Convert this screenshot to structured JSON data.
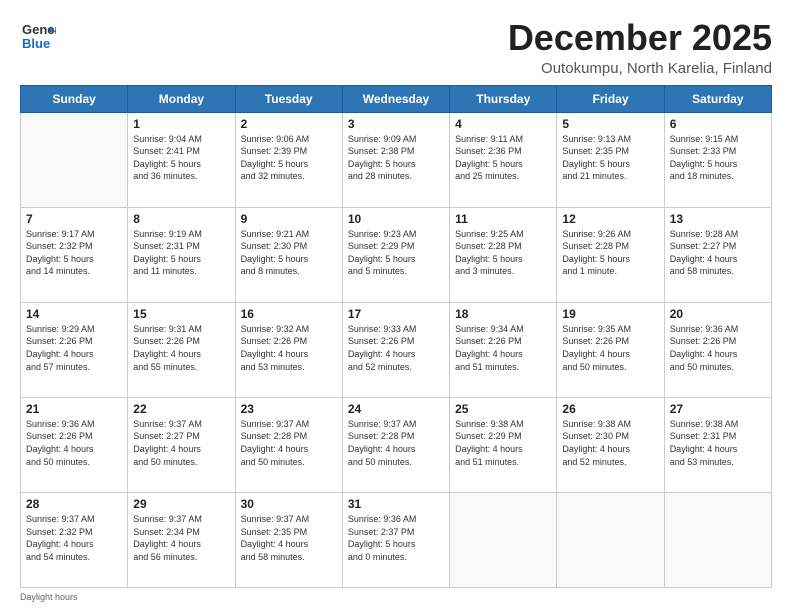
{
  "header": {
    "logo_general": "General",
    "logo_blue": "Blue",
    "month_title": "December 2025",
    "location": "Outokumpu, North Karelia, Finland"
  },
  "days_of_week": [
    "Sunday",
    "Monday",
    "Tuesday",
    "Wednesday",
    "Thursday",
    "Friday",
    "Saturday"
  ],
  "weeks": [
    [
      {
        "day": "",
        "info": ""
      },
      {
        "day": "1",
        "info": "Sunrise: 9:04 AM\nSunset: 2:41 PM\nDaylight: 5 hours\nand 36 minutes."
      },
      {
        "day": "2",
        "info": "Sunrise: 9:06 AM\nSunset: 2:39 PM\nDaylight: 5 hours\nand 32 minutes."
      },
      {
        "day": "3",
        "info": "Sunrise: 9:09 AM\nSunset: 2:38 PM\nDaylight: 5 hours\nand 28 minutes."
      },
      {
        "day": "4",
        "info": "Sunrise: 9:11 AM\nSunset: 2:36 PM\nDaylight: 5 hours\nand 25 minutes."
      },
      {
        "day": "5",
        "info": "Sunrise: 9:13 AM\nSunset: 2:35 PM\nDaylight: 5 hours\nand 21 minutes."
      },
      {
        "day": "6",
        "info": "Sunrise: 9:15 AM\nSunset: 2:33 PM\nDaylight: 5 hours\nand 18 minutes."
      }
    ],
    [
      {
        "day": "7",
        "info": "Sunrise: 9:17 AM\nSunset: 2:32 PM\nDaylight: 5 hours\nand 14 minutes."
      },
      {
        "day": "8",
        "info": "Sunrise: 9:19 AM\nSunset: 2:31 PM\nDaylight: 5 hours\nand 11 minutes."
      },
      {
        "day": "9",
        "info": "Sunrise: 9:21 AM\nSunset: 2:30 PM\nDaylight: 5 hours\nand 8 minutes."
      },
      {
        "day": "10",
        "info": "Sunrise: 9:23 AM\nSunset: 2:29 PM\nDaylight: 5 hours\nand 5 minutes."
      },
      {
        "day": "11",
        "info": "Sunrise: 9:25 AM\nSunset: 2:28 PM\nDaylight: 5 hours\nand 3 minutes."
      },
      {
        "day": "12",
        "info": "Sunrise: 9:26 AM\nSunset: 2:28 PM\nDaylight: 5 hours\nand 1 minute."
      },
      {
        "day": "13",
        "info": "Sunrise: 9:28 AM\nSunset: 2:27 PM\nDaylight: 4 hours\nand 58 minutes."
      }
    ],
    [
      {
        "day": "14",
        "info": "Sunrise: 9:29 AM\nSunset: 2:26 PM\nDaylight: 4 hours\nand 57 minutes."
      },
      {
        "day": "15",
        "info": "Sunrise: 9:31 AM\nSunset: 2:26 PM\nDaylight: 4 hours\nand 55 minutes."
      },
      {
        "day": "16",
        "info": "Sunrise: 9:32 AM\nSunset: 2:26 PM\nDaylight: 4 hours\nand 53 minutes."
      },
      {
        "day": "17",
        "info": "Sunrise: 9:33 AM\nSunset: 2:26 PM\nDaylight: 4 hours\nand 52 minutes."
      },
      {
        "day": "18",
        "info": "Sunrise: 9:34 AM\nSunset: 2:26 PM\nDaylight: 4 hours\nand 51 minutes."
      },
      {
        "day": "19",
        "info": "Sunrise: 9:35 AM\nSunset: 2:26 PM\nDaylight: 4 hours\nand 50 minutes."
      },
      {
        "day": "20",
        "info": "Sunrise: 9:36 AM\nSunset: 2:26 PM\nDaylight: 4 hours\nand 50 minutes."
      }
    ],
    [
      {
        "day": "21",
        "info": "Sunrise: 9:36 AM\nSunset: 2:26 PM\nDaylight: 4 hours\nand 50 minutes."
      },
      {
        "day": "22",
        "info": "Sunrise: 9:37 AM\nSunset: 2:27 PM\nDaylight: 4 hours\nand 50 minutes."
      },
      {
        "day": "23",
        "info": "Sunrise: 9:37 AM\nSunset: 2:28 PM\nDaylight: 4 hours\nand 50 minutes."
      },
      {
        "day": "24",
        "info": "Sunrise: 9:37 AM\nSunset: 2:28 PM\nDaylight: 4 hours\nand 50 minutes."
      },
      {
        "day": "25",
        "info": "Sunrise: 9:38 AM\nSunset: 2:29 PM\nDaylight: 4 hours\nand 51 minutes."
      },
      {
        "day": "26",
        "info": "Sunrise: 9:38 AM\nSunset: 2:30 PM\nDaylight: 4 hours\nand 52 minutes."
      },
      {
        "day": "27",
        "info": "Sunrise: 9:38 AM\nSunset: 2:31 PM\nDaylight: 4 hours\nand 53 minutes."
      }
    ],
    [
      {
        "day": "28",
        "info": "Sunrise: 9:37 AM\nSunset: 2:32 PM\nDaylight: 4 hours\nand 54 minutes."
      },
      {
        "day": "29",
        "info": "Sunrise: 9:37 AM\nSunset: 2:34 PM\nDaylight: 4 hours\nand 56 minutes."
      },
      {
        "day": "30",
        "info": "Sunrise: 9:37 AM\nSunset: 2:35 PM\nDaylight: 4 hours\nand 58 minutes."
      },
      {
        "day": "31",
        "info": "Sunrise: 9:36 AM\nSunset: 2:37 PM\nDaylight: 5 hours\nand 0 minutes."
      },
      {
        "day": "",
        "info": ""
      },
      {
        "day": "",
        "info": ""
      },
      {
        "day": "",
        "info": ""
      }
    ]
  ],
  "footer": {
    "note": "Daylight hours"
  }
}
